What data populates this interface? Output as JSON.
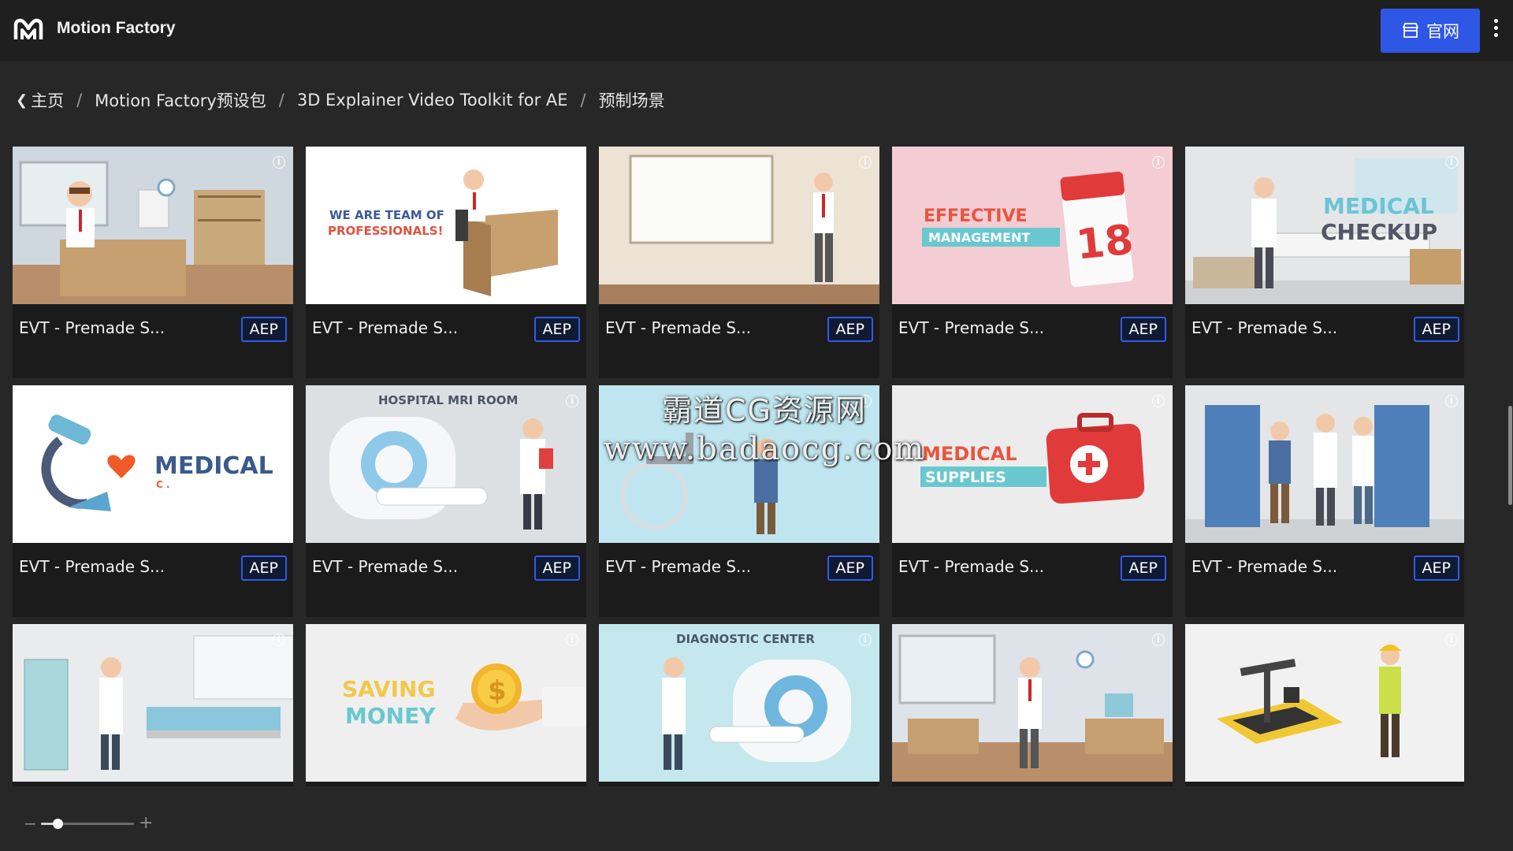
{
  "header": {
    "brand": "Motion Factory",
    "official_button": "官网"
  },
  "breadcrumb": [
    {
      "label": "主页"
    },
    {
      "label": "Motion Factory预设包"
    },
    {
      "label": "3D Explainer Video Toolkit for AE"
    },
    {
      "label": "预制场景"
    }
  ],
  "cards": [
    {
      "title": "EVT - Premade S...",
      "badge": "AEP"
    },
    {
      "title": "EVT - Premade S...",
      "badge": "AEP"
    },
    {
      "title": "EVT - Premade S...",
      "badge": "AEP"
    },
    {
      "title": "EVT - Premade S...",
      "badge": "AEP"
    },
    {
      "title": "EVT - Premade S...",
      "badge": "AEP"
    },
    {
      "title": "EVT - Premade S...",
      "badge": "AEP"
    },
    {
      "title": "EVT - Premade S...",
      "badge": "AEP"
    },
    {
      "title": "EVT - Premade S...",
      "badge": "AEP"
    },
    {
      "title": "EVT - Premade S...",
      "badge": "AEP"
    },
    {
      "title": "EVT - Premade S...",
      "badge": "AEP"
    },
    {
      "title": "",
      "badge": ""
    },
    {
      "title": "",
      "badge": ""
    },
    {
      "title": "",
      "badge": ""
    },
    {
      "title": "",
      "badge": ""
    },
    {
      "title": "",
      "badge": ""
    }
  ],
  "thumbnail_text": {
    "t2": [
      "WE ARE TEAM OF",
      "PROFESSIONALS!"
    ],
    "t4": [
      "EFFECTIVE",
      "MANAGEMENT",
      "18"
    ],
    "t5": [
      "MEDICAL",
      "CHECKUP"
    ],
    "t6": [
      "MEDICAL",
      "C ."
    ],
    "t7": [
      "HOSPITAL MRI ROOM"
    ],
    "t9": [
      "MEDICAL",
      "SUPPLIES"
    ],
    "t12": [
      "SAVING",
      "MONEY",
      "$"
    ],
    "t13": [
      "DIAGNOSTIC CENTER"
    ]
  },
  "watermark": {
    "line1": "霸道CG资源网",
    "line2": "www.badaocg.com"
  },
  "zoom": {
    "minus": "−",
    "plus": "+",
    "level": 0.18
  },
  "icons": {
    "logo": "motion-factory-logo",
    "official": "store-icon",
    "more": "more-vertical-icon",
    "back": "chevron-left-icon",
    "info": "info-icon"
  },
  "colors": {
    "accent": "#2f57e6",
    "background": "#272727",
    "header": "#1f1f1f",
    "card": "#1b1b1b"
  }
}
